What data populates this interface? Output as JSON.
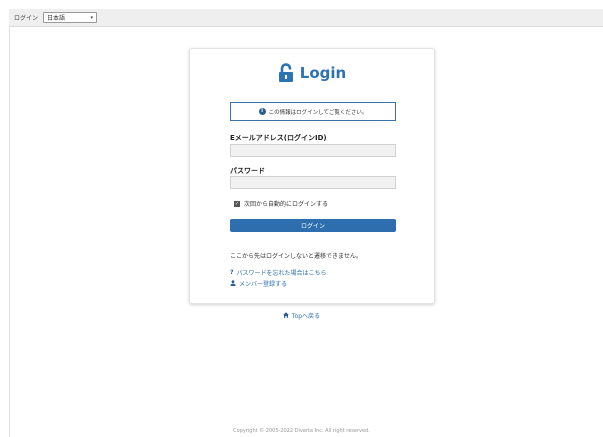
{
  "top_bar": {
    "label": "ログイン",
    "language": "日本語"
  },
  "login": {
    "title": "Login",
    "info_message": "この情報はログインしてご覧ください。",
    "email_label": "Eメールアドレス(ログインID)",
    "email_value": "",
    "password_label": "パスワード",
    "password_value": "",
    "remember_label": "次回から自動的にログインする",
    "remember_checked": true,
    "submit_label": "ログイン",
    "notice": "ここから先はログインしないと遷移できません。",
    "forgot_password_link": "パスワードを忘れた場合はこちら",
    "register_link": "メンバー登録する"
  },
  "back_link": "Topへ戻る",
  "footer": "Copyright © 2005-2022 Diverta Inc. All right reserved.",
  "colors": {
    "accent": "#2c73b4",
    "button": "#2e6eae",
    "info_border": "#3b72a8"
  },
  "icons": {
    "lock": "lock-icon",
    "info": "info-icon",
    "help": "question-icon",
    "user": "user-icon",
    "home": "home-icon"
  }
}
